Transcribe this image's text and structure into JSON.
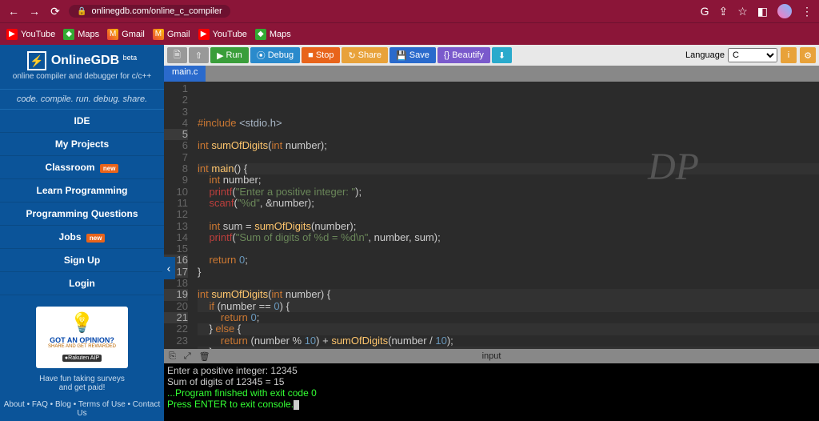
{
  "browser": {
    "url": "onlinegdb.com/online_c_compiler",
    "bookmarks": [
      {
        "icon": "yt",
        "label": "YouTube"
      },
      {
        "icon": "maps",
        "label": "Maps"
      },
      {
        "icon": "gmail",
        "label": "Gmail"
      },
      {
        "icon": "gmail",
        "label": "Gmail"
      },
      {
        "icon": "yt",
        "label": "YouTube"
      },
      {
        "icon": "maps",
        "label": "Maps"
      }
    ]
  },
  "sidebar": {
    "title": "OnlineGDB",
    "beta": "beta",
    "tagline": "online compiler and debugger for c/c++",
    "motto": "code. compile. run. debug. share.",
    "items": [
      "IDE",
      "My Projects",
      "Classroom",
      "Learn Programming",
      "Programming Questions",
      "Jobs",
      "Sign Up",
      "Login"
    ],
    "badges": {
      "2": "new",
      "5": "new"
    },
    "ad": {
      "title": "GOT AN OPINION?",
      "sub": "SHARE AND GET REWARDED",
      "brand": "●Rakuten AIP",
      "text1": "Have fun taking surveys",
      "text2": "and get paid!"
    },
    "footer": "About • FAQ • Blog • Terms of Use • Contact Us"
  },
  "toolbar": {
    "run": "Run",
    "debug": "Debug",
    "stop": "Stop",
    "share": "Share",
    "save": "Save",
    "beautify": "Beautify",
    "lang_label": "Language",
    "lang_value": "C"
  },
  "tab": "main.c",
  "code_lines": [
    {
      "n": 1,
      "html": "<span class='pp'>#include</span> <span class='inc'>&lt;stdio.h&gt;</span>"
    },
    {
      "n": 2,
      "html": ""
    },
    {
      "n": 3,
      "html": "<span class='kw'>int</span> <span class='fn'>sumOfDigits</span>(<span class='kw'>int</span> number);"
    },
    {
      "n": 4,
      "html": ""
    },
    {
      "n": 5,
      "html": "<span class='kw'>int</span> <span class='fn'>main</span>() {",
      "active": true
    },
    {
      "n": 6,
      "html": "    <span class='kw'>int</span> number;"
    },
    {
      "n": 7,
      "html": "    <span class='err'>printf</span>(<span class='str'>\"Enter a positive integer: \"</span>);"
    },
    {
      "n": 8,
      "html": "    <span class='err'>scanf</span>(<span class='str'>\"%d\"</span>, &amp;number);"
    },
    {
      "n": 9,
      "html": ""
    },
    {
      "n": 10,
      "html": "    <span class='kw'>int</span> sum = <span class='fn'>sumOfDigits</span>(number);"
    },
    {
      "n": 11,
      "html": "    <span class='err'>printf</span>(<span class='str'>\"Sum of digits of %d = %d\\n\"</span>, number, sum);"
    },
    {
      "n": 12,
      "html": ""
    },
    {
      "n": 13,
      "html": "    <span class='kw'>return</span> <span class='num'>0</span>;"
    },
    {
      "n": 14,
      "html": "}"
    },
    {
      "n": 15,
      "html": ""
    },
    {
      "n": 16,
      "html": "<span class='kw'>int</span> <span class='fn'>sumOfDigits</span>(<span class='kw'>int</span> number) {",
      "active": true
    },
    {
      "n": 17,
      "html": "    <span class='kw'>if</span> (number == <span class='num'>0</span>) {",
      "active": true
    },
    {
      "n": 18,
      "html": "        <span class='kw'>return</span> <span class='num'>0</span>;"
    },
    {
      "n": 19,
      "html": "    } <span class='kw'>else</span> {",
      "active": true
    },
    {
      "n": 20,
      "html": "        <span class='kw'>return</span> (number % <span class='num'>10</span>) + <span class='fn'>sumOfDigits</span>(number / <span class='num'>10</span>);"
    },
    {
      "n": 21,
      "html": "    }",
      "active": true
    },
    {
      "n": 22,
      "html": "}"
    },
    {
      "n": 23,
      "html": ""
    }
  ],
  "watermark": "DP",
  "console_bar": "input",
  "console": [
    {
      "text": "Enter a positive integer: 12345",
      "cls": ""
    },
    {
      "text": "Sum of digits of 12345 = 15",
      "cls": ""
    },
    {
      "text": "",
      "cls": ""
    },
    {
      "text": "...Program finished with exit code 0",
      "cls": "con-ok"
    },
    {
      "text": "Press ENTER to exit console.",
      "cls": "con-ok",
      "cursor": true
    }
  ]
}
